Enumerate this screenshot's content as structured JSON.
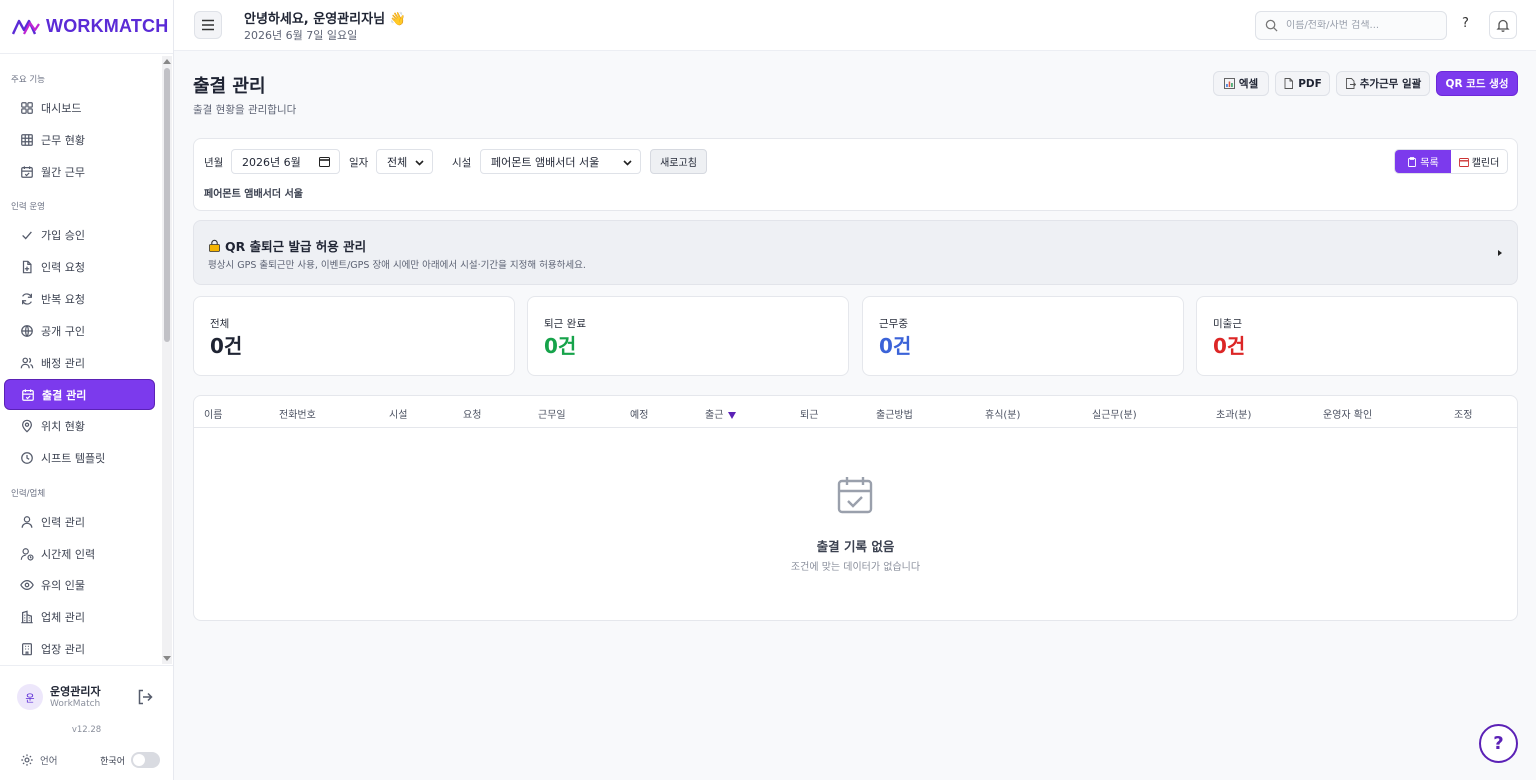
{
  "brand": {
    "name": "WORKMATCH",
    "accent": "#7c3aed"
  },
  "sidebar": {
    "sections": [
      {
        "title": "주요 기능",
        "items": [
          {
            "label": "대시보드",
            "icon": "grid-icon"
          },
          {
            "label": "근무 현황",
            "icon": "table-icon"
          },
          {
            "label": "월간 근무",
            "icon": "calendar-check-icon"
          }
        ]
      },
      {
        "title": "인력 운영",
        "items": [
          {
            "label": "가입 승인",
            "icon": "check-icon"
          },
          {
            "label": "인력 요청",
            "icon": "file-plus-icon"
          },
          {
            "label": "반복 요청",
            "icon": "refresh-icon"
          },
          {
            "label": "공개 구인",
            "icon": "globe-icon"
          },
          {
            "label": "배정 관리",
            "icon": "users-icon"
          },
          {
            "label": "출결 관리",
            "icon": "calendar-check-icon",
            "active": true
          },
          {
            "label": "위치 현황",
            "icon": "map-pin-icon"
          },
          {
            "label": "시프트 템플릿",
            "icon": "clock-icon"
          }
        ]
      },
      {
        "title": "인력/업체",
        "items": [
          {
            "label": "인력 관리",
            "icon": "user-icon"
          },
          {
            "label": "시간제 인력",
            "icon": "user-clock-icon"
          },
          {
            "label": "유의 인물",
            "icon": "eye-icon"
          },
          {
            "label": "업체 관리",
            "icon": "building-icon"
          },
          {
            "label": "업장 관리",
            "icon": "building-2-icon"
          }
        ]
      }
    ],
    "profile": {
      "avatar": "운",
      "name": "운영관리자",
      "sub": "WorkMatch"
    },
    "version": "v12.28",
    "language": {
      "label": "언어",
      "value": "한국어"
    }
  },
  "header": {
    "greeting": "안녕하세요, 운영관리자님 👋",
    "date": "2026년 6월 7일 일요일",
    "search_placeholder": "이름/전화/사번 검색...",
    "help": "?"
  },
  "page": {
    "title": "출결 관리",
    "subtitle": "출결 현황을 관리합니다",
    "actions": {
      "excel": "엑셀",
      "pdf": "PDF",
      "overtime": "추가근무 일괄",
      "qr": "QR 코드 생성"
    }
  },
  "filter": {
    "month_label": "년월",
    "month_value": "2026년 6월",
    "day_label": "일자",
    "day_value": "전체",
    "facility_label": "시설",
    "facility_value": "페어몬트 앰배서더 서울",
    "refresh": "새로고침",
    "facility_sub": "페어몬트 앰배서더 서울",
    "view_list": "목록",
    "view_calendar": "캘린더"
  },
  "qr_panel": {
    "title": "QR 출퇴근 발급 허용 관리",
    "desc": "평상시 GPS 출퇴근만 사용, 이벤트/GPS 장애 시에만 아래에서 시설·기간을 지정해 허용하세요."
  },
  "stats": [
    {
      "label": "전체",
      "value": "0건",
      "color": "#1f2433"
    },
    {
      "label": "퇴근 완료",
      "value": "0건",
      "color": "#16a34a"
    },
    {
      "label": "근무중",
      "value": "0건",
      "color": "#3b63d8"
    },
    {
      "label": "미출근",
      "value": "0건",
      "color": "#dc2626"
    }
  ],
  "table": {
    "columns": [
      "이름",
      "전화번호",
      "시설",
      "요청",
      "근무일",
      "예정",
      "출근",
      "퇴근",
      "출근방법",
      "휴식(분)",
      "실근무(분)",
      "초과(분)",
      "운영자 확인",
      "조정"
    ],
    "sorted_column": "출근",
    "empty_title": "출결 기록 없음",
    "empty_sub": "조건에 맞는 데이터가 없습니다"
  },
  "help_fab": "?"
}
